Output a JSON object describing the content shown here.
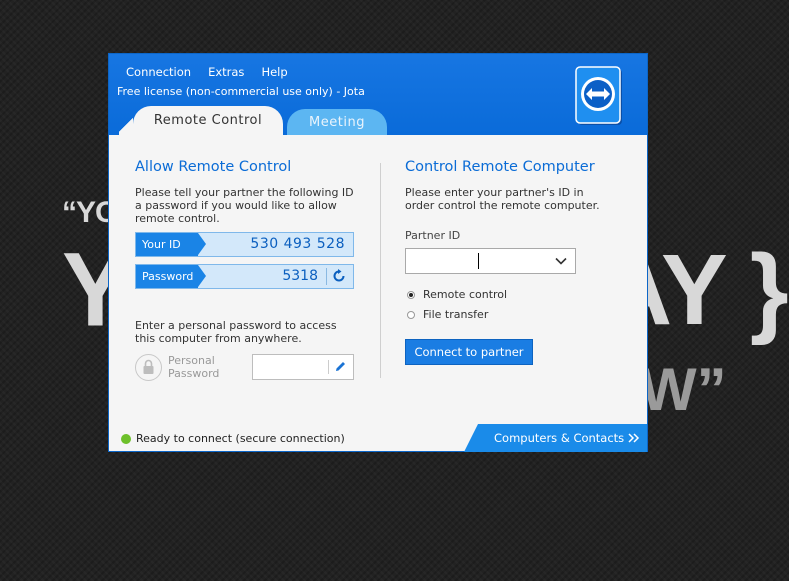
{
  "background": {
    "line1": "“YO",
    "line2": "YC",
    "line3": "AY }",
    "line4": "W”"
  },
  "window": {
    "menu": [
      "Connection",
      "Extras",
      "Help"
    ],
    "license": "Free license (non-commercial use only) - Jota",
    "tabs": {
      "active": "Remote Control",
      "inactive": "Meeting"
    },
    "allow": {
      "title": "Allow Remote Control",
      "desc": "Please tell your partner the following ID a password if you would like to allow remote control.",
      "your_id_label": "Your ID",
      "your_id": "530 493 528",
      "password_label": "Password",
      "password": "5318",
      "personal_desc": "Enter a personal password to access this computer from anywhere.",
      "personal_label": "Personal Password"
    },
    "control": {
      "title": "Control Remote Computer",
      "desc": "Please enter your partner's ID in order control the remote computer.",
      "partner_id_label": "Partner ID",
      "partner_id_value": "",
      "radio_remote": "Remote control",
      "radio_file": "File transfer",
      "connect_label": "Connect to partner"
    },
    "status": "Ready to connect (secure connection)",
    "contacts": "Computers & Contacts"
  },
  "colors": {
    "header_blue": "#0a6bd9",
    "accent": "#1a7de3",
    "status_green": "#6dc02a"
  }
}
